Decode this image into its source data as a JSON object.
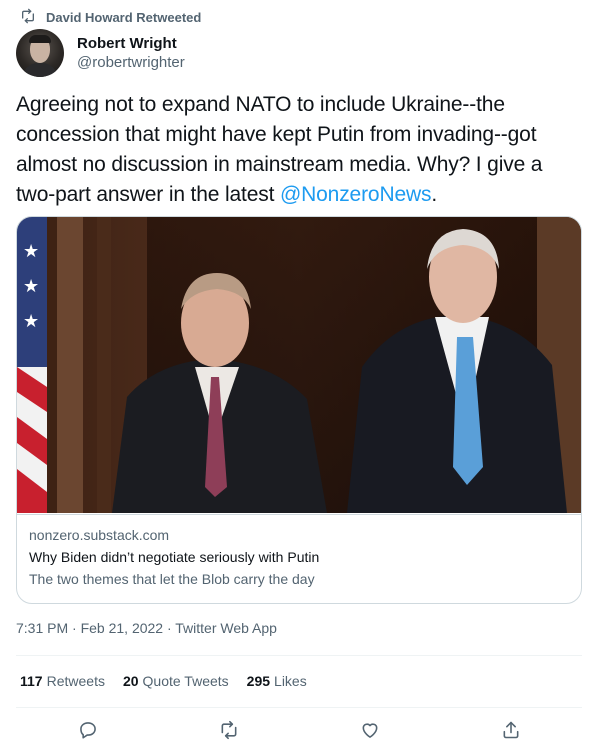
{
  "social_context": {
    "text": "David Howard Retweeted",
    "icon": "retweet-icon"
  },
  "author": {
    "display_name": "Robert Wright",
    "handle": "@robertwrighter"
  },
  "tweet": {
    "text_before_mention": "Agreeing not to expand NATO to include Ukraine--the concession that might have kept Putin from invading--got almost no discussion in mainstream media. Why? I give a two-part answer in the latest ",
    "mention": "@NonzeroNews",
    "text_after_mention": "."
  },
  "card": {
    "domain": "nonzero.substack.com",
    "title": "Why Biden didn’t negotiate seriously with Putin",
    "description": "The two themes that let the Blob carry the day"
  },
  "timestamp": "7:31 PM · Feb 21, 2022 · Twitter Web App",
  "stats": [
    {
      "count": "117",
      "label": "Retweets"
    },
    {
      "count": "20",
      "label": "Quote Tweets"
    },
    {
      "count": "295",
      "label": "Likes"
    }
  ],
  "actions": [
    "reply-icon",
    "retweet-icon",
    "like-icon",
    "share-icon"
  ],
  "colors": {
    "link": "#1d9bf0",
    "text_primary": "#0f1419",
    "text_secondary": "#536471",
    "border": "#cfd9de"
  }
}
